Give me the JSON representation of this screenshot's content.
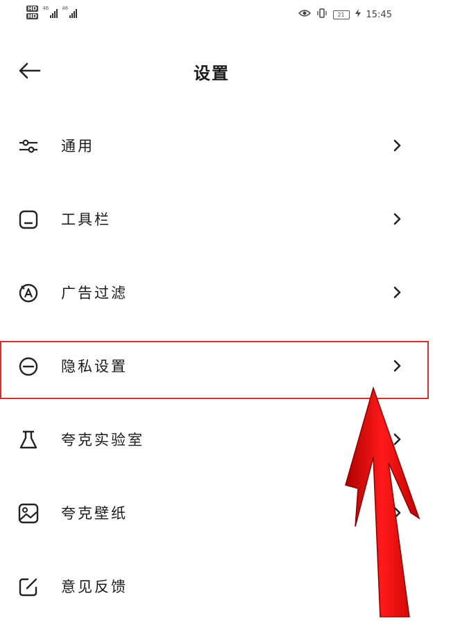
{
  "status_bar": {
    "hd_badge_1": "HD",
    "hd_badge_2": "HD",
    "signal_1_label": "46",
    "signal_2_label": "46",
    "time": "15:45",
    "battery_level": "21"
  },
  "header": {
    "title": "设置"
  },
  "menu": {
    "items": [
      {
        "label": "通用",
        "icon": "sliders-icon"
      },
      {
        "label": "工具栏",
        "icon": "toolbar-icon"
      },
      {
        "label": "广告过滤",
        "icon": "ad-block-icon"
      },
      {
        "label": "隐私设置",
        "icon": "privacy-face-icon"
      },
      {
        "label": "夸克实验室",
        "icon": "flask-icon"
      },
      {
        "label": "夸克壁纸",
        "icon": "wallpaper-icon"
      },
      {
        "label": "意见反馈",
        "icon": "feedback-edit-icon"
      }
    ]
  },
  "colors": {
    "highlight": "#d32f2f",
    "annotation_arrow": "#e01010",
    "text": "#1a1a1a"
  }
}
